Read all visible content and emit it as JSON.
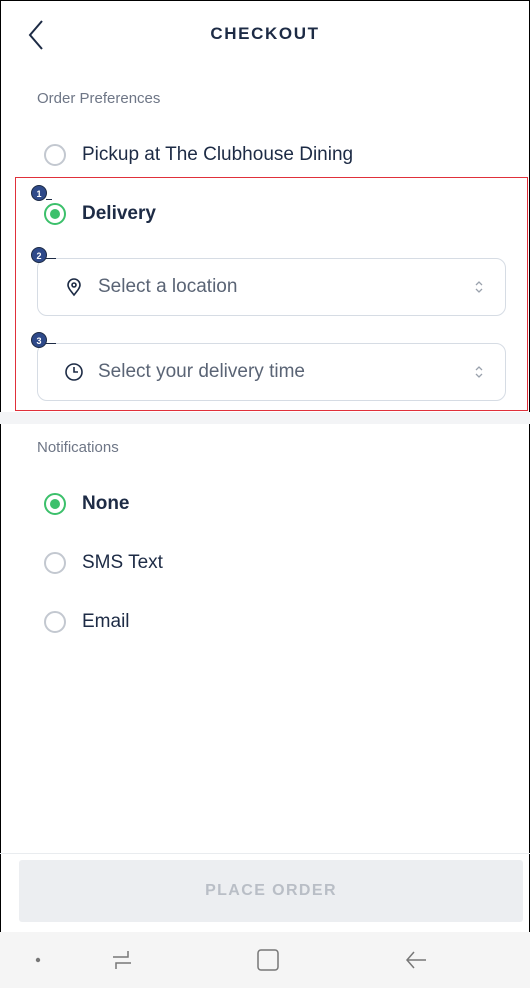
{
  "header": {
    "title": "CHECKOUT"
  },
  "order_preferences": {
    "label": "Order Preferences",
    "options": [
      {
        "label": "Pickup at The Clubhouse Dining",
        "selected": false
      },
      {
        "label": "Delivery",
        "selected": true
      }
    ],
    "location_placeholder": "Select a location",
    "time_placeholder": "Select your delivery time"
  },
  "annotations": {
    "badge_1": "1",
    "badge_2": "2",
    "badge_3": "3"
  },
  "notifications": {
    "label": "Notifications",
    "options": [
      {
        "label": "None",
        "selected": true
      },
      {
        "label": "SMS Text",
        "selected": false
      },
      {
        "label": "Email",
        "selected": false
      }
    ]
  },
  "footer": {
    "place_order_label": "PLACE ORDER"
  },
  "colors": {
    "accent_green": "#3cc06b",
    "text_navy": "#1d2b45",
    "highlight_red": "#e0303a",
    "badge_blue": "#2f4a8a"
  },
  "icons": {
    "back": "chevron-left-icon",
    "location": "location-pin-icon",
    "time": "clock-icon",
    "select": "updown-chevron-icon"
  }
}
